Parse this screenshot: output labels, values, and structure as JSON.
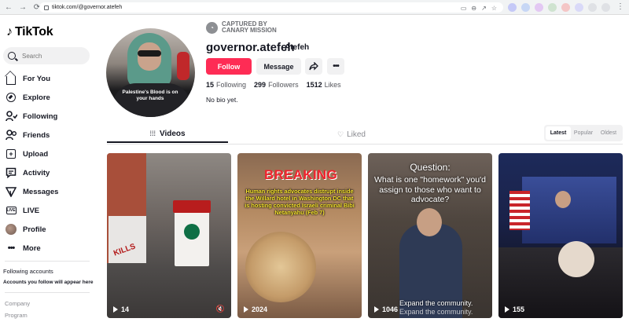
{
  "browser": {
    "url": "tiktok.com/@governor.atefeh",
    "back_glyph": "←",
    "forward_glyph": "→",
    "reload_glyph": "⟳",
    "tool_glyphs": [
      "▭",
      "⊖",
      "↗",
      "☆"
    ],
    "menu_glyph": "⋮"
  },
  "sidebar": {
    "logo_text": "TikTok",
    "search_placeholder": "Search",
    "nav": [
      {
        "label": "For You",
        "icon": "house-icon"
      },
      {
        "label": "Explore",
        "icon": "compass-icon"
      },
      {
        "label": "Following",
        "icon": "following-icon"
      },
      {
        "label": "Friends",
        "icon": "friends-icon"
      },
      {
        "label": "Upload",
        "icon": "upload-icon"
      },
      {
        "label": "Activity",
        "icon": "activity-icon"
      },
      {
        "label": "Messages",
        "icon": "messages-icon"
      },
      {
        "label": "LIVE",
        "icon": "live-icon"
      },
      {
        "label": "Profile",
        "icon": "profile-avatar-icon"
      },
      {
        "label": "More",
        "icon": "more-dots-icon"
      }
    ],
    "following_accounts_title": "Following accounts",
    "following_accounts_sub": "Accounts you follow will appear here",
    "footer_links": [
      "Company",
      "Program"
    ]
  },
  "profile": {
    "badge_line1": "CAPTURED BY",
    "badge_line2": "CANARY MISSION",
    "username": "governor.atefeh",
    "display_name": "Atefeh",
    "follow_label": "Follow",
    "message_label": "Message",
    "avatar_shirt_text": "Palestine's Blood is on your hands",
    "stats": {
      "following_count": "15",
      "following_label": "Following",
      "followers_count": "299",
      "followers_label": "Followers",
      "likes_count": "1512",
      "likes_label": "Likes"
    },
    "bio": "No bio yet."
  },
  "tabs": {
    "videos_label": "Videos",
    "liked_label": "Liked",
    "sort_options": [
      "Latest",
      "Popular",
      "Oldest"
    ],
    "sort_selected": "Latest"
  },
  "videos": [
    {
      "views": "14",
      "overlay_text": "KILLS"
    },
    {
      "views": "2024",
      "overlay_title": "BREAKING",
      "overlay_text": "Human rights advocates distrupt inside the Willard hotel in Washington DC that is hosting convicted Israeli criminal Bibi Netanyahu (Feb 7)"
    },
    {
      "views": "1046",
      "overlay_title": "Question:",
      "overlay_text": "What is one \"homework\" you'd assign to those who want to advocate?",
      "footer_text": "Expand the community."
    },
    {
      "views": "155"
    }
  ],
  "colors": {
    "accent": "#fe2c55",
    "text": "#161823",
    "muted": "#8a8b91",
    "surface": "#f1f1f2"
  }
}
